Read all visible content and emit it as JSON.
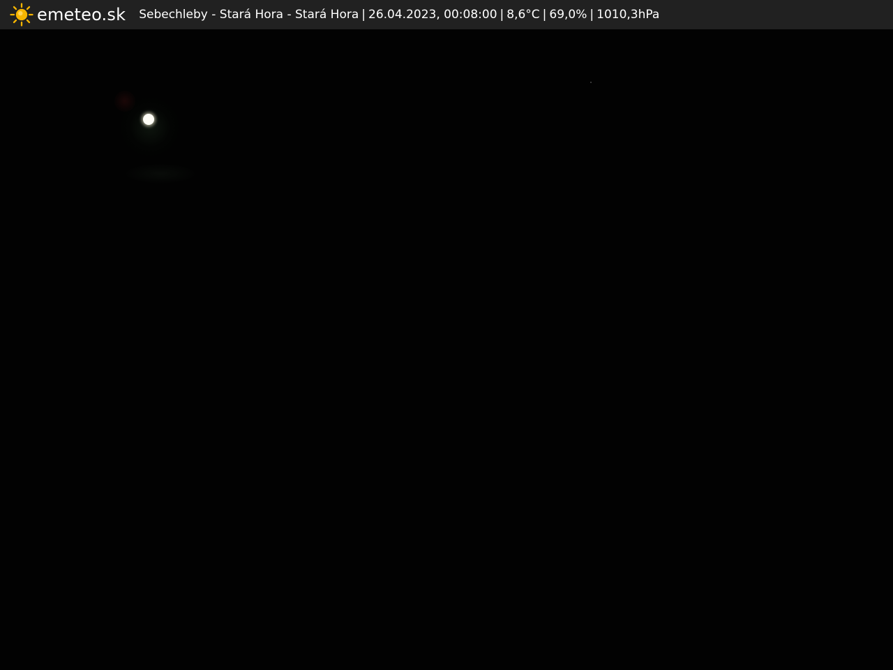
{
  "header": {
    "brand": "emeteo.sk",
    "location": "Sebechleby - Stará Hora - Stará Hora",
    "datetime": "26.04.2023, 00:08:00",
    "temperature": "8,6°C",
    "humidity": "69,0%",
    "pressure": "1010,3hPa",
    "separator": "|"
  },
  "colors": {
    "header_background": "#212121",
    "sun": "#f7b500",
    "text": "#ffffff"
  },
  "icons": {
    "logo": "sun-icon"
  }
}
